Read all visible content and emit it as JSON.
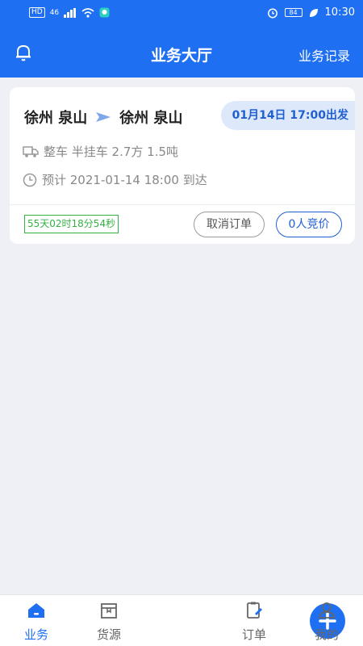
{
  "status_bar": {
    "left_tags": [
      "HD",
      "46"
    ],
    "battery": "84",
    "time": "10:30"
  },
  "header": {
    "title": "业务大厅",
    "right_action": "业务记录"
  },
  "order": {
    "from": "徐州 泉山",
    "to": "徐州 泉山",
    "depart": "01月14日 17:00出发",
    "cargo": "整车 半挂车 2.7方 1.5吨",
    "eta": "预计 2021-01-14 18:00 到达",
    "countdown": "55天02时18分54秒",
    "cancel_label": "取消订单",
    "bid_label": "0人竞价"
  },
  "tabbar": {
    "items": [
      {
        "label": "业务",
        "icon": "home-icon",
        "active": true
      },
      {
        "label": "货源",
        "icon": "cargo-box-icon",
        "active": false
      },
      {
        "label": "",
        "icon": "plus-icon",
        "active": false
      },
      {
        "label": "订单",
        "icon": "order-edit-icon",
        "active": false
      },
      {
        "label": "我的",
        "icon": "user-icon",
        "active": false
      }
    ]
  },
  "colors": {
    "primary": "#1f6ff2",
    "timer_green": "#34b145",
    "background": "#eef0f6"
  }
}
